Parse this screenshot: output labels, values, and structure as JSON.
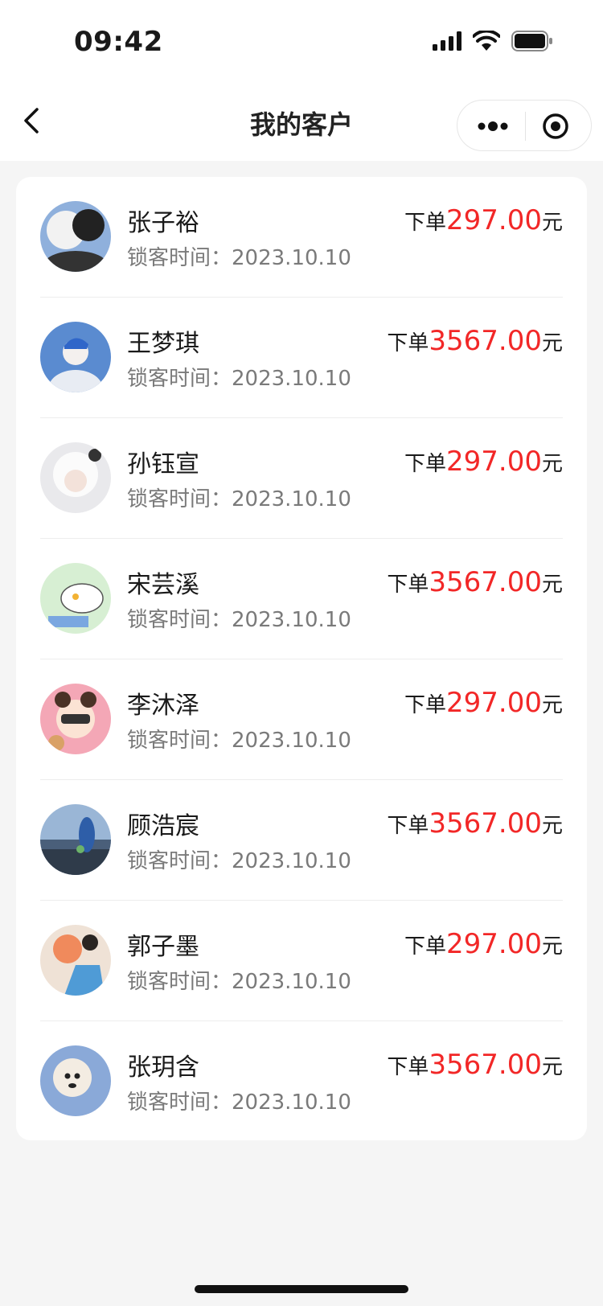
{
  "status_bar": {
    "time": "09:42"
  },
  "nav": {
    "title": "我的客户"
  },
  "list": {
    "lock_label": "锁客时间：",
    "order_prefix": "下单",
    "order_suffix": "元",
    "amount_color": "#f22727",
    "items": [
      {
        "name": "张子裕",
        "lock_time": "2023.10.10",
        "amount": "297.00"
      },
      {
        "name": "王梦琪",
        "lock_time": "2023.10.10",
        "amount": "3567.00"
      },
      {
        "name": "孙钰宣",
        "lock_time": "2023.10.10",
        "amount": "297.00"
      },
      {
        "name": "宋芸溪",
        "lock_time": "2023.10.10",
        "amount": "3567.00"
      },
      {
        "name": "李沐泽",
        "lock_time": "2023.10.10",
        "amount": "297.00"
      },
      {
        "name": "顾浩宸",
        "lock_time": "2023.10.10",
        "amount": "3567.00"
      },
      {
        "name": "郭子墨",
        "lock_time": "2023.10.10",
        "amount": "297.00"
      },
      {
        "name": "张玥含",
        "lock_time": "2023.10.10",
        "amount": "3567.00"
      }
    ]
  }
}
